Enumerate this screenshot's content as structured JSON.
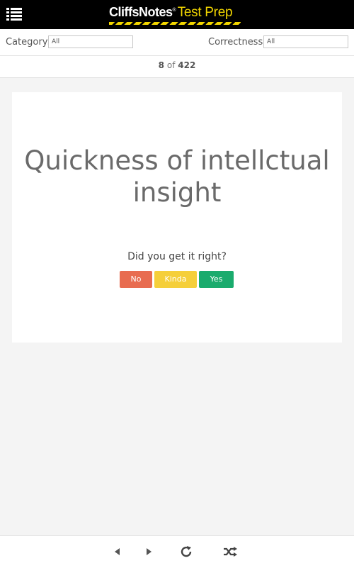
{
  "header": {
    "logo_brand": "CliffsNotes",
    "logo_reg": "®",
    "logo_product": "Test Prep",
    "menu_icon": "hamburger-list-icon"
  },
  "filters": {
    "category_label": "Category:",
    "category_value": "All",
    "correctness_label": "Correctness:",
    "correctness_value": "All"
  },
  "counter": {
    "current": "8",
    "of": "of",
    "total": "422"
  },
  "card": {
    "term": "Quickness of intellctual insight",
    "prompt": "Did you get it right?",
    "buttons": {
      "no": "No",
      "kinda": "Kinda",
      "yes": "Yes"
    }
  },
  "bottom_nav": {
    "prev_icon": "triangle-left-icon",
    "next_icon": "triangle-right-icon",
    "reload_icon": "refresh-icon",
    "shuffle_icon": "shuffle-icon"
  },
  "colors": {
    "header_bg": "#000000",
    "brand_yellow": "#f2d600",
    "no": "#e86c50",
    "kinda": "#f5cf3a",
    "yes": "#1aab6d",
    "page_bg": "#f4f4f4"
  }
}
